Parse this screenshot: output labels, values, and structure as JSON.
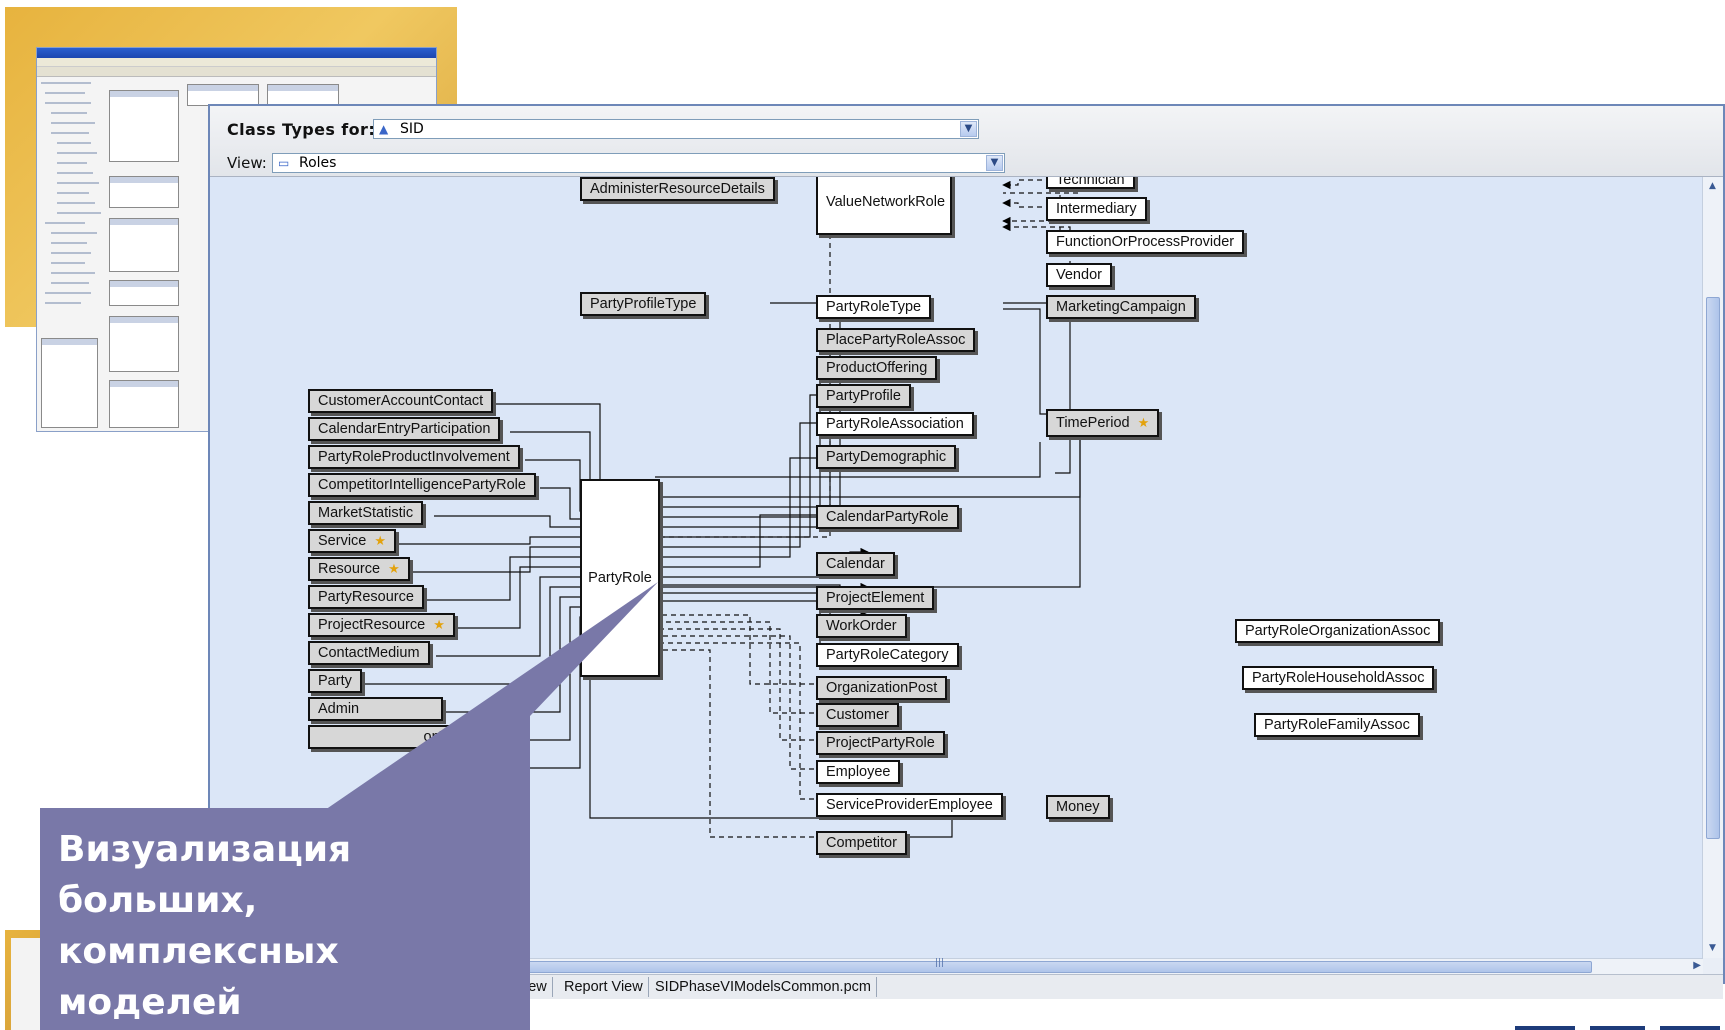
{
  "toolbar": {
    "class_types_label": "Class Types for:",
    "class_types_value": "SID",
    "class_types_icon": "triangle-icon",
    "view_label": "View:",
    "view_value": "Roles",
    "view_icon": "folder-icon"
  },
  "diagram": {
    "nodes": {
      "administer_resource_details": "AdministerResourceDetails",
      "value_network_role": "ValueNetworkRole",
      "technician": "Technician",
      "intermediary": "Intermediary",
      "function_or_process_provider": "FunctionOrProcessProvider",
      "vendor": "Vendor",
      "party_profile_type": "PartyProfileType",
      "party_role_type": "PartyRoleType",
      "marketing_campaign": "MarketingCampaign",
      "place_party_role_assoc": "PlacePartyRoleAssoc",
      "product_offering": "ProductOffering",
      "party_profile": "PartyProfile",
      "party_role_association": "PartyRoleAssociation",
      "time_period": "TimePeriod",
      "party_demographic": "PartyDemographic",
      "customer_account_contact": "CustomerAccountContact",
      "calendar_entry_participation": "CalendarEntryParticipation",
      "party_role_product_involvement": "PartyRoleProductInvolvement",
      "competitor_intelligence_party_role": "CompetitorIntelligencePartyRole",
      "market_statistic": "MarketStatistic",
      "service": "Service",
      "resource": "Resource",
      "party_resource": "PartyResource",
      "project_resource": "ProjectResource",
      "contact_medium": "ContactMedium",
      "party": "Party",
      "admin_partial": "Admin",
      "version_partial": "onVersion",
      "party_role": "PartyRole",
      "calendar_party_role": "CalendarPartyRole",
      "calendar": "Calendar",
      "project_element": "ProjectElement",
      "work_order": "WorkOrder",
      "party_role_category": "PartyRoleCategory",
      "organization_post": "OrganizationPost",
      "customer": "Customer",
      "project_party_role": "ProjectPartyRole",
      "employee": "Employee",
      "service_provider_employee": "ServiceProviderEmployee",
      "money": "Money",
      "competitor": "Competitor",
      "party_role_organization_assoc": "PartyRoleOrganizationAssoc",
      "party_role_household_assoc": "PartyRoleHouseholdAssoc",
      "party_role_family_assoc": "PartyRoleFamilyAssoc"
    }
  },
  "tabs": {
    "tab1": "iew",
    "tab2": "Report View",
    "tab3": "SIDPhaseVIModelsCommon.pcm"
  },
  "callout": {
    "text": "Визуализация больших, комплексных моделей"
  },
  "colors": {
    "callout_bg": "#7978a8",
    "diagram_bg": "#dbe6f7",
    "thumbnail_bg": "#e7b33e"
  }
}
